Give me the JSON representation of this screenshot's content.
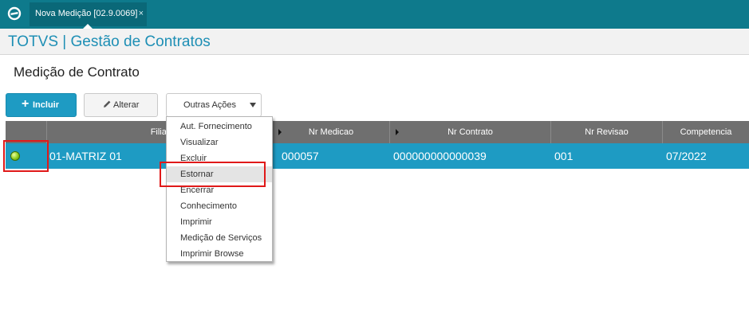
{
  "tab": {
    "label": "Nova Medição [02.9.0069]",
    "close": "×"
  },
  "app": {
    "title": "TOTVS | Gestão de Contratos"
  },
  "page": {
    "title": "Medição de Contrato"
  },
  "toolbar": {
    "include_icon": "+",
    "include_label": "Incluir",
    "edit_label": "Alterar",
    "more_label": "Outras Ações"
  },
  "grid": {
    "columns": [
      "Filial",
      "Nr Medicao",
      "Nr Contrato",
      "Nr Revisao",
      "Competencia"
    ],
    "row": {
      "status": "green",
      "filial": "01-MATRIZ 01",
      "nr_medicao": "000057",
      "nr_contrato": "000000000000039",
      "nr_revisao": "001",
      "competencia": "07/2022"
    }
  },
  "menu": {
    "items": [
      "Aut. Fornecimento",
      "Visualizar",
      "Excluir",
      "Estornar",
      "Encerrar",
      "Conhecimento",
      "Imprimir",
      "Medição de Serviços",
      "Imprimir Browse"
    ],
    "highlighted": "Estornar"
  },
  "colors": {
    "accent": "#1e9bc3",
    "topbar": "#0e7a8c",
    "highlight_box": "#e01919",
    "status_ok": "#8ccc1e"
  }
}
